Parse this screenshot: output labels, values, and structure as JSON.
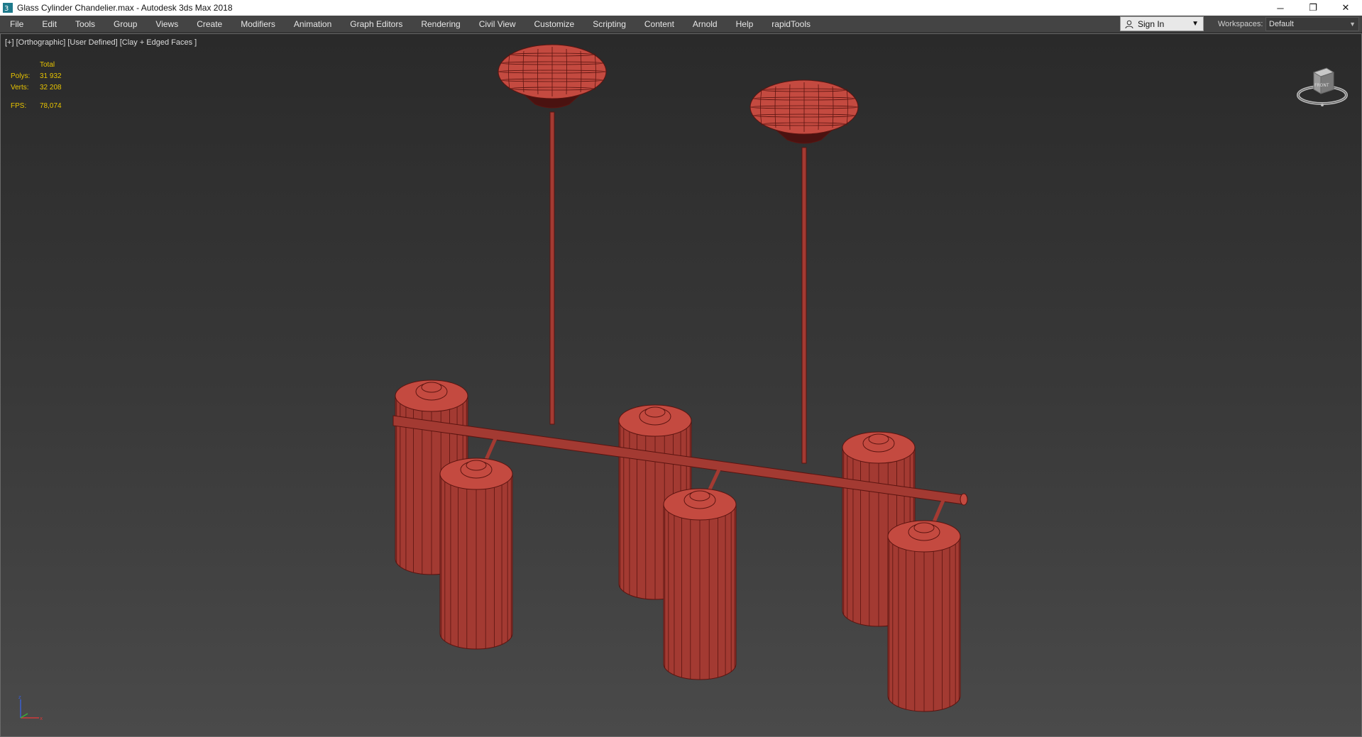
{
  "window": {
    "title": "Glass Cylinder Chandelier.max - Autodesk 3ds Max 2018",
    "app_icon": "3ds-max-icon",
    "controls": {
      "minimize": "─",
      "restore": "❐",
      "close": "✕"
    }
  },
  "menubar": {
    "items": [
      "File",
      "Edit",
      "Tools",
      "Group",
      "Views",
      "Create",
      "Modifiers",
      "Animation",
      "Graph Editors",
      "Rendering",
      "Civil View",
      "Customize",
      "Scripting",
      "Content",
      "Arnold",
      "Help",
      "rapidTools"
    ]
  },
  "signin": {
    "label": "Sign In",
    "icon": "user-icon"
  },
  "workspaces": {
    "label": "Workspaces:",
    "value": "Default"
  },
  "viewport": {
    "label": "[+] [Orthographic] [User Defined] [Clay + Edged Faces ]",
    "stats": {
      "header": "Total",
      "polys_label": "Polys:",
      "polys_value": "31 932",
      "verts_label": "Verts:",
      "verts_value": "32 208",
      "fps_label": "FPS:",
      "fps_value": "78,074"
    },
    "viewcube_label": "FRONT",
    "model_color": "#a33a32",
    "model_edge_color": "#5a1410"
  }
}
